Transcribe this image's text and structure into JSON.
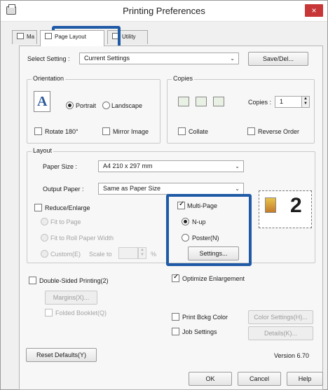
{
  "window": {
    "title": "Printing Preferences",
    "close_glyph": "×"
  },
  "tabs": [
    "Ma",
    "Page Layout",
    "Utility"
  ],
  "select_setting": {
    "label": "Select Setting :",
    "value": "Current Settings",
    "button": "Save/Del..."
  },
  "orientation": {
    "group": "Orientation",
    "portrait": "Portrait",
    "landscape": "Landscape",
    "selected": "Portrait",
    "rotate": "Rotate 180°",
    "mirror": "Mirror Image"
  },
  "copies": {
    "group": "Copies",
    "label": "Copies :",
    "value": "1",
    "collate": "Collate",
    "reverse": "Reverse Order"
  },
  "layout": {
    "group": "Layout",
    "paper_size_label": "Paper Size :",
    "paper_size": "A4 210 x 297 mm",
    "output_paper_label": "Output Paper :",
    "output_paper": "Same as Paper Size",
    "reduce_enlarge": "Reduce/Enlarge",
    "fit_page": "Fit to Page",
    "fit_roll": "Fit to Roll Paper Width",
    "custom": "Custom(E)",
    "scale_to": "Scale to",
    "percent": "%",
    "multi_page": "Multi-Page",
    "nup": "N-up",
    "poster": "Poster(N)",
    "settings": "Settings...",
    "preview_number": "2"
  },
  "double_sided": {
    "label": "Double-Sided Printing(2)",
    "margins": "Margins(X)...",
    "folded": "Folded Booklet(Q)"
  },
  "optimize": "Optimize Enlargement",
  "print_bckg": {
    "label": "Print Bckg Color",
    "button": "Color Settings(H)..."
  },
  "job_settings": {
    "label": "Job Settings",
    "button": "Details(K)..."
  },
  "footer": {
    "reset": "Reset Defaults(Y)",
    "version": "Version 6.70",
    "ok": "OK",
    "cancel": "Cancel",
    "help": "Help"
  },
  "colors": {
    "highlight": "#1f5aa6",
    "close": "#c83737"
  }
}
